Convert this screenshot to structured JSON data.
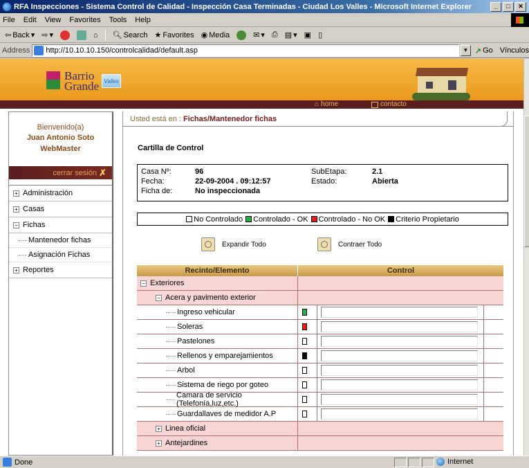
{
  "window": {
    "title": "RFA Inspecciones - Sistema Control de Calidad - Inspección Casa Terminadas - Ciudad Los Valles - Microsoft Internet Explorer"
  },
  "menubar": [
    "File",
    "Edit",
    "View",
    "Favorites",
    "Tools",
    "Help"
  ],
  "toolbar": {
    "back": "Back",
    "search": "Search",
    "favorites": "Favorites",
    "media": "Media"
  },
  "address": {
    "label": "Address",
    "url": "http://10.10.10.150/controlcalidad/default.asp",
    "go": "Go",
    "links": "Vínculos"
  },
  "header": {
    "logo_line1": "Barrio",
    "logo_line2": "Grande",
    "badge": "Valles",
    "nav_home": "home",
    "nav_contact": "contacto"
  },
  "sidebar": {
    "greeting": "Bienvenido(a)",
    "user_name": "Juan Antonio Soto",
    "user_role": "WebMaster",
    "logout": "cerrar sesión",
    "items": [
      {
        "label": "Administración",
        "sign": "+"
      },
      {
        "label": "Casas",
        "sign": "+"
      },
      {
        "label": "Fichas",
        "sign": "−"
      }
    ],
    "subitems": [
      "Mantenedor fichas",
      "Asignación Fichas"
    ],
    "last_item": {
      "label": "Reportes",
      "sign": "+"
    }
  },
  "main": {
    "breadcrumb_prefix": "Usted está en :",
    "breadcrumb_path": "Fichas/Mantenedor fichas",
    "title": "Cartilla de Control",
    "info": {
      "casa_label": "Casa Nº:",
      "casa_value": "96",
      "fecha_label": "Fecha:",
      "fecha_value": "22-09-2004 . 09:12:57",
      "ficha_label": "Ficha de:",
      "ficha_value": "No inspeccionada",
      "subetapa_label": "SubEtapa:",
      "subetapa_value": "2.1",
      "estado_label": "Estado:",
      "estado_value": "Abierta"
    },
    "legend": [
      {
        "label": "No Controlado",
        "color": "#ffffff"
      },
      {
        "label": "Controlado - OK",
        "color": "#22b04a"
      },
      {
        "label": "Controlado - No OK",
        "color": "#e81c1c"
      },
      {
        "label": "Criterio Propietario",
        "color": "#000000"
      }
    ],
    "expand_label": "Expandir Todo",
    "collapse_label": "Contraer Todo",
    "table": {
      "col1": "Recinto/Elemento",
      "col2": "Control",
      "group": "Exteriores",
      "subgroup": "Acera y pavimento exterior",
      "rows": [
        {
          "label": "Ingreso vehicular",
          "status": "#22b04a"
        },
        {
          "label": "Soleras",
          "status": "#e81c1c"
        },
        {
          "label": "Pastelones",
          "status": "#ffffff"
        },
        {
          "label": "Rellenos y emparejamientos",
          "status": "#000000"
        },
        {
          "label": "Arbol",
          "status": "#ffffff"
        },
        {
          "label": "Sistema de riego por goteo",
          "status": "#ffffff"
        },
        {
          "label": "Camara de servicio (Telefonía,luz,etc.)",
          "status": "#ffffff"
        },
        {
          "label": "Guardallaves de medidor A.P",
          "status": "#ffffff"
        }
      ],
      "collapsed_groups": [
        "Linea oficial",
        "Antejardines"
      ]
    }
  },
  "status": {
    "text": "Done",
    "zone": "Internet"
  }
}
